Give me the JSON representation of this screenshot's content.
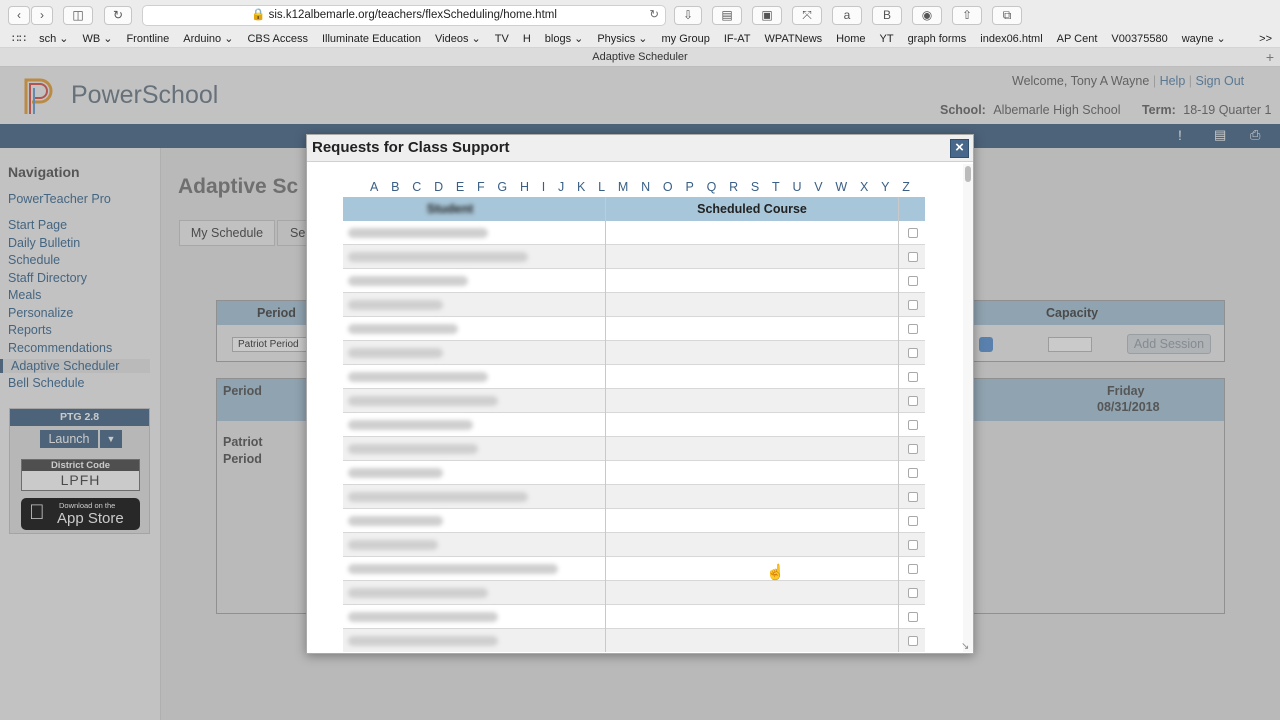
{
  "browser": {
    "url": "sis.k12albemarle.org/teachers/flexScheduling/home.html",
    "bookmarks": [
      "sch ⌄",
      "WB ⌄",
      "Frontline",
      "Arduino ⌄",
      "CBS Access",
      "Illuminate Education",
      "Videos ⌄",
      "TV",
      "H",
      "blogs ⌄",
      "Physics ⌄",
      "my Group",
      "IF-AT",
      "WPATNews",
      "Home",
      "YT",
      "graph forms",
      "index06.html",
      "AP Cent",
      "V00375580",
      "wayne ⌄"
    ],
    "overflow": ">>",
    "tab_title": "Adaptive Scheduler",
    "new_tab": "+"
  },
  "header": {
    "logo": "PowerSchool",
    "welcome": "Welcome, Tony A Wayne",
    "help": "Help",
    "signout": "Sign Out",
    "school_label": "School:",
    "school": "Albemarle High School",
    "term_label": "Term:",
    "term": "18-19 Quarter 1"
  },
  "sidebar": {
    "heading": "Navigation",
    "ptpro": "PowerTeacher Pro",
    "items": [
      "Start Page",
      "Daily Bulletin",
      "Schedule",
      "Staff Directory",
      "Meals",
      "Personalize",
      "Reports",
      "Recommendations",
      "Adaptive Scheduler",
      "Bell Schedule"
    ],
    "ptg_title": "PTG 2.8",
    "launch": "Launch",
    "district_code_label": "District Code",
    "district_code": "LPFH",
    "appstore_small": "Download on the",
    "appstore_big": "App Store"
  },
  "main": {
    "title": "Adaptive Sc",
    "tabs": [
      "My Schedule",
      "Se"
    ],
    "period_header": "Period",
    "period_select": "Patriot Period",
    "capacity_header": "Capacity",
    "add_session": "Add Session",
    "grid_period": "Period",
    "grid_day": "Friday",
    "grid_date": "08/31/2018",
    "grid_row": "Patriot Period"
  },
  "modal": {
    "title": "Requests for Class Support",
    "close": "×",
    "letters": [
      "A",
      "B",
      "C",
      "D",
      "E",
      "F",
      "G",
      "H",
      "I",
      "J",
      "K",
      "L",
      "M",
      "N",
      "O",
      "P",
      "Q",
      "R",
      "S",
      "T",
      "U",
      "V",
      "W",
      "X",
      "Y",
      "Z"
    ],
    "col_student": "Student",
    "col_course": "Scheduled Course",
    "row_count": 18,
    "colors": {
      "header_bg": "#a8c6d9",
      "accent": "#3a5f86"
    }
  }
}
